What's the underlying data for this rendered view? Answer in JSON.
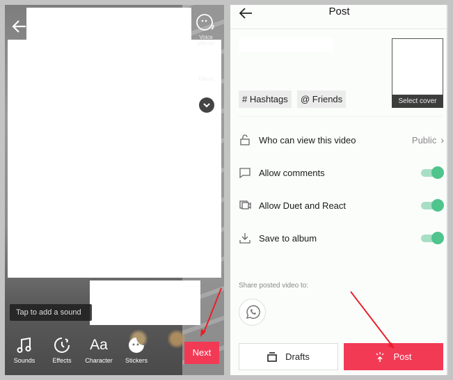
{
  "editor": {
    "side_tools": [
      {
        "icon": "voice-effects-icon",
        "label": "Voice\neffects"
      },
      {
        "icon": "filters-icon",
        "label": "Filters"
      }
    ],
    "expand_icon": "chevron-down-icon",
    "tap_sound_hint": "Tap to add a sound",
    "bottom_tools": [
      {
        "icon": "music-note-icon",
        "label": "Sounds"
      },
      {
        "icon": "timer-icon",
        "label": "Effects"
      },
      {
        "icon": "text-icon",
        "glyph": "Aa",
        "label": "Character"
      },
      {
        "icon": "sticker-icon",
        "label": "Stickers"
      }
    ],
    "next_label": "Next"
  },
  "post": {
    "title": "Post",
    "chips": [
      "# Hashtags",
      "@ Friends"
    ],
    "cover_label": "Select cover",
    "settings": [
      {
        "icon": "lock-icon",
        "label": "Who can view this video",
        "value": "Public",
        "type": "link"
      },
      {
        "icon": "comment-icon",
        "label": "Allow comments",
        "type": "toggle",
        "on": true
      },
      {
        "icon": "duet-icon",
        "label": "Allow Duet and React",
        "type": "toggle",
        "on": true
      },
      {
        "icon": "download-icon",
        "label": "Save to album",
        "type": "toggle",
        "on": true
      }
    ],
    "share_label": "Share posted video to:",
    "share_targets": [
      "whatsapp"
    ],
    "drafts_label": "Drafts",
    "post_label": "Post"
  },
  "colors": {
    "accent_red": "#f23a55",
    "toggle_green": "#4fc48d",
    "annotation_arrow": "#e8202a"
  }
}
